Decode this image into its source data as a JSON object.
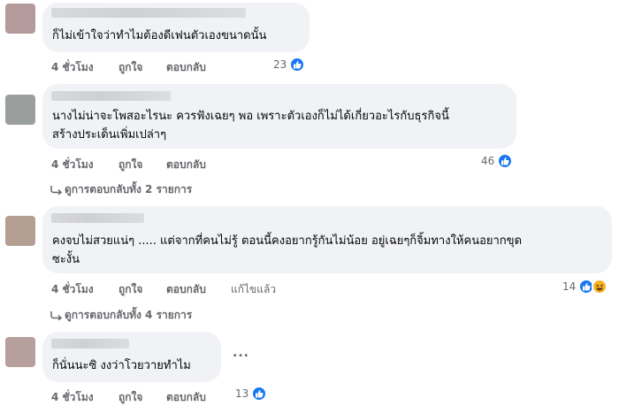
{
  "comments": [
    {
      "text_lines": [
        "ก็ไม่เข้าใจว่าทำไมต้องดีเฟนตัวเองขนาดนั้น"
      ],
      "time": "4 ชั่วโมง",
      "like": "ถูกใจ",
      "reply": "ตอบกลับ",
      "reaction_count": "23",
      "reactions": [
        "like-icon"
      ]
    },
    {
      "text_lines": [
        "นางไม่น่าจะโพสอะไรนะ ควรฟังเฉยๆ พอ เพราะตัวเองก็ไม่ได้เกี่ยวอะไรกับธุรกิจนี้",
        "สร้างประเด็นเพิ่มเปล่าๆ"
      ],
      "time": "4 ชั่วโมง",
      "like": "ถูกใจ",
      "reply": "ตอบกลับ",
      "reaction_count": "46",
      "reactions": [
        "like-icon"
      ],
      "view_replies": "ดูการตอบกลับทั้ง 2 รายการ"
    },
    {
      "text_lines": [
        "คงจบไม่สวยแน่ๆ ..... แต่จากที่คนไม่รู้ ตอนนี้คงอยากรู้กันไม่น้อย อยู่เฉยๆก็จิ้มทางให้คนอยากขุด",
        "ซะงั้น"
      ],
      "time": "4 ชั่วโมง",
      "like": "ถูกใจ",
      "reply": "ตอบกลับ",
      "edited": "แก้ไขแล้ว",
      "reaction_count": "14",
      "reactions": [
        "like-icon",
        "haha-icon"
      ],
      "view_replies": "ดูการตอบกลับทั้ง 4 รายการ"
    },
    {
      "text_lines": [
        "ก็นั่นนะซิ งงว่าโวยวายทำไม"
      ],
      "time": "4 ชั่วโมง",
      "like": "ถูกใจ",
      "reply": "ตอบกลับ",
      "reaction_count": "13",
      "reactions": [
        "like-icon"
      ],
      "more": "..."
    }
  ],
  "colors": {
    "bubble": "#f0f2f5",
    "meta": "#65676b",
    "like_blue": "#1877f2",
    "haha_yellow": "#f7b125"
  }
}
